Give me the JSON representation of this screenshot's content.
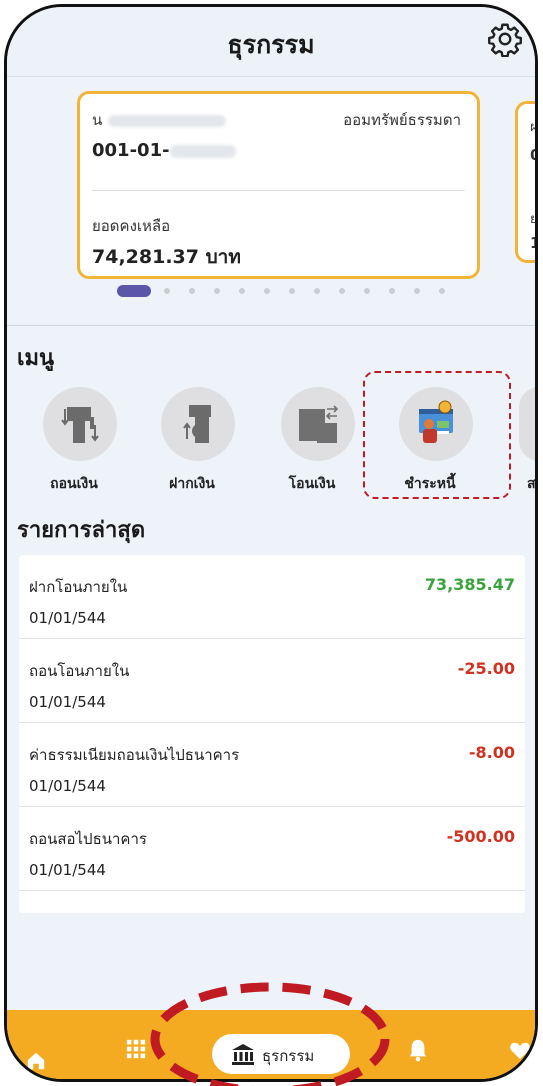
{
  "header": {
    "title": "ธุรกรรม"
  },
  "account_card": {
    "name_prefix": "น",
    "account_type": "ออมทรัพย์ธรรมดา",
    "account_no": "001-01-",
    "balance_label": "ยอดคงเหลือ",
    "balance_value": "74,281.37 บาท"
  },
  "peek_card": {
    "line1": "ฝ",
    "line2": "0",
    "line3": "ย",
    "line4": "1"
  },
  "menu": {
    "title": "เมนู",
    "items": [
      {
        "label": "ถอนเงิน",
        "icon": "withdraw-icon"
      },
      {
        "label": "ฝากเงิน",
        "icon": "deposit-icon"
      },
      {
        "label": "โอนเงิน",
        "icon": "transfer-icon"
      },
      {
        "label": "ชำระหนี้",
        "icon": "pay-debt-icon"
      }
    ],
    "peek_label": "ส"
  },
  "recent": {
    "title": "รายการล่าสุด",
    "items": [
      {
        "desc": "ฝากโอนภายใน",
        "date": "01/01/544",
        "amount": "73,385.47",
        "color": "#3aa33c"
      },
      {
        "desc": "ถอนโอนภายใน",
        "date": "01/01/544",
        "amount": "-25.00",
        "color": "#d0321f"
      },
      {
        "desc": "ค่าธรรมเนียมถอนเงินไปธนาคาร",
        "date": "01/01/544",
        "amount": "-8.00",
        "color": "#d0321f"
      },
      {
        "desc": "ถอนสอไปธนาคาร",
        "date": "01/01/544",
        "amount": "-500.00",
        "color": "#d0321f"
      }
    ]
  },
  "bottom_nav": {
    "active_label": "ธุรกรรม"
  },
  "colors": {
    "accent": "#f4ab21",
    "card_border": "#f2b438",
    "highlight": "#c01b22"
  }
}
